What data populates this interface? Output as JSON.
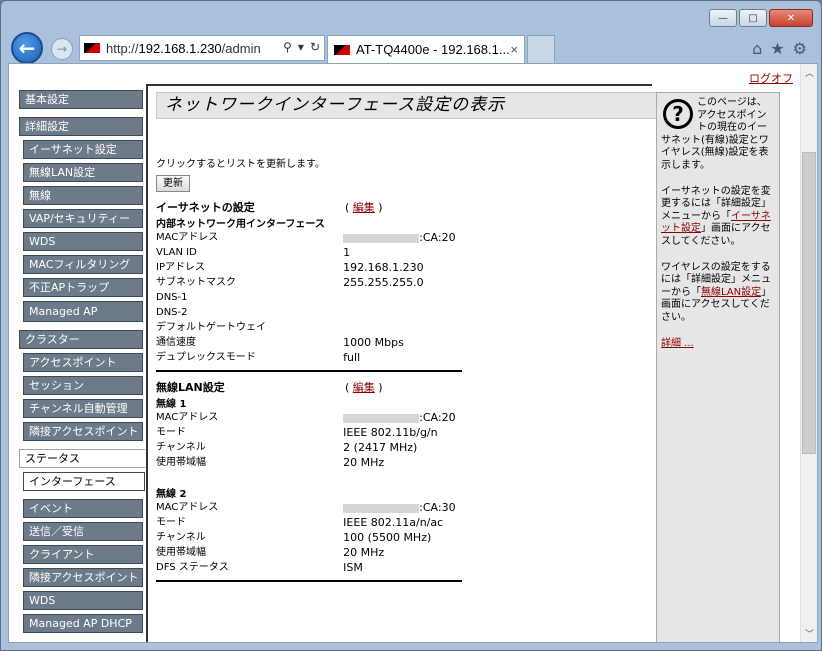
{
  "browser": {
    "url_prefix": "http://",
    "url_host": "192.168.1.230",
    "url_path": "/admin",
    "tab_title": "AT-TQ4400e - 192.168.1...",
    "tab_close": "×",
    "addr_search": "⚲",
    "addr_dropdown": "▾",
    "addr_refresh": "↻",
    "win_minimize": "—",
    "win_maximize": "□",
    "win_close": "✕",
    "back": "←",
    "forward": "→",
    "home": "⌂",
    "favorites": "★",
    "tools": "⚙"
  },
  "header": {
    "logout": "ログオフ"
  },
  "nav": {
    "basic": "基本設定",
    "advanced": "詳細設定",
    "advanced_items": [
      "イーサネット設定",
      "無線LAN設定",
      "無線",
      "VAP/セキュリティー",
      "WDS",
      "MACフィルタリング",
      "不正APトラップ",
      "Managed AP"
    ],
    "cluster": "クラスター",
    "cluster_items": [
      "アクセスポイント",
      "セッション",
      "チャンネル自動管理",
      "隣接アクセスポイント"
    ],
    "status": "ステータス",
    "status_active": "インターフェース",
    "status_items": [
      "イベント",
      "送信／受信",
      "クライアント",
      "隣接アクセスポイント",
      "WDS",
      "Managed AP DHCP"
    ]
  },
  "main": {
    "title": "ネットワークインターフェース設定の表示",
    "refresh_note": "クリックするとリストを更新します。",
    "refresh_button": "更新",
    "ethernet": {
      "heading": "イーサネットの設定",
      "edit": "編集",
      "subheading": "内部ネットワーク用インターフェース",
      "rows": [
        {
          "k": "MACアドレス",
          "v": ":CA:20",
          "redacted": true
        },
        {
          "k": "VLAN ID",
          "v": "1"
        },
        {
          "k": "IPアドレス",
          "v": "192.168.1.230"
        },
        {
          "k": "サブネットマスク",
          "v": "255.255.255.0"
        },
        {
          "k": "DNS-1",
          "v": ""
        },
        {
          "k": "DNS-2",
          "v": ""
        },
        {
          "k": "デフォルトゲートウェイ",
          "v": ""
        },
        {
          "k": "通信速度",
          "v": "1000 Mbps"
        },
        {
          "k": "デュプレックスモード",
          "v": "full"
        }
      ]
    },
    "wireless": {
      "heading": "無線LAN設定",
      "edit": "編集",
      "radio1": {
        "label": "無線 1",
        "rows": [
          {
            "k": "MACアドレス",
            "v": ":CA:20",
            "redacted": true
          },
          {
            "k": "モード",
            "v": "IEEE 802.11b/g/n"
          },
          {
            "k": "チャンネル",
            "v": "2 (2417 MHz)"
          },
          {
            "k": "使用帯域幅",
            "v": "20 MHz"
          }
        ]
      },
      "radio2": {
        "label": "無線 2",
        "rows": [
          {
            "k": "MACアドレス",
            "v": ":CA:30",
            "redacted": true
          },
          {
            "k": "モード",
            "v": "IEEE 802.11a/n/ac"
          },
          {
            "k": "チャンネル",
            "v": "100 (5500 MHz)"
          },
          {
            "k": "使用帯域幅",
            "v": "20 MHz"
          },
          {
            "k": "DFS ステータス",
            "v": "ISM"
          }
        ]
      }
    }
  },
  "help": {
    "icon": "?",
    "p1": "このページは、アクセスポイントの現在のイーサネット(有線)設定とワイヤレス(無線)設定を表示します。",
    "p2_before": "イーサネットの設定を変更するには「詳細設定」メニューから「",
    "p2_link": "イーサネット設定",
    "p2_after": "」画面にアクセスしてください。",
    "p3_before": "ワイヤレスの設定をするには「詳細設定」メニューから「",
    "p3_link": "無線LAN設定",
    "p3_after": "」画面にアクセスしてください。",
    "more": "詳細 ..."
  }
}
